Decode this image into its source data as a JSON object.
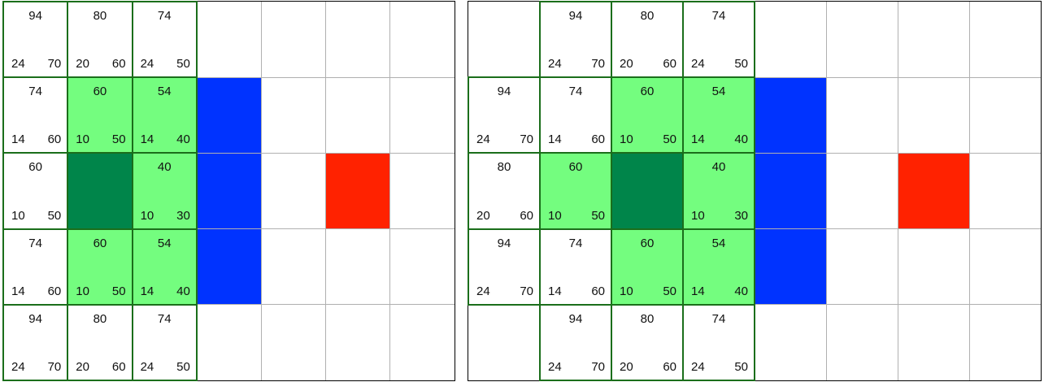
{
  "colors": {
    "open": "#74fd7f",
    "closed": "#ffffff",
    "current": "#00854a",
    "wall": "#0033ff",
    "goal": "#ff2200",
    "border": "#1b6e1b",
    "gridline": "#b0b0b0"
  },
  "legend": {
    "cell_values": "each annotated cell shows f (top), g (bottom-left), h (bottom-right)"
  },
  "panels": [
    {
      "cols": 7,
      "rows": 5,
      "wall_cells": [
        [
          3,
          1
        ],
        [
          3,
          2
        ],
        [
          3,
          3
        ]
      ],
      "goal_cells": [
        [
          5,
          2
        ]
      ],
      "current_cell": [
        1,
        2
      ],
      "cells": [
        {
          "c": 0,
          "r": 0,
          "state": "closed",
          "f": "94",
          "g": "24",
          "h": "70"
        },
        {
          "c": 1,
          "r": 0,
          "state": "closed",
          "f": "80",
          "g": "20",
          "h": "60"
        },
        {
          "c": 2,
          "r": 0,
          "state": "closed",
          "f": "74",
          "g": "24",
          "h": "50"
        },
        {
          "c": 0,
          "r": 1,
          "state": "closed",
          "f": "74",
          "g": "14",
          "h": "60"
        },
        {
          "c": 1,
          "r": 1,
          "state": "open",
          "f": "60",
          "g": "10",
          "h": "50"
        },
        {
          "c": 2,
          "r": 1,
          "state": "open",
          "f": "54",
          "g": "14",
          "h": "40"
        },
        {
          "c": 0,
          "r": 2,
          "state": "closed",
          "f": "60",
          "g": "10",
          "h": "50"
        },
        {
          "c": 2,
          "r": 2,
          "state": "open",
          "f": "40",
          "g": "10",
          "h": "30"
        },
        {
          "c": 0,
          "r": 3,
          "state": "closed",
          "f": "74",
          "g": "14",
          "h": "60"
        },
        {
          "c": 1,
          "r": 3,
          "state": "open",
          "f": "60",
          "g": "10",
          "h": "50"
        },
        {
          "c": 2,
          "r": 3,
          "state": "open",
          "f": "54",
          "g": "14",
          "h": "40"
        },
        {
          "c": 0,
          "r": 4,
          "state": "closed",
          "f": "94",
          "g": "24",
          "h": "70"
        },
        {
          "c": 1,
          "r": 4,
          "state": "closed",
          "f": "80",
          "g": "20",
          "h": "60"
        },
        {
          "c": 2,
          "r": 4,
          "state": "closed",
          "f": "74",
          "g": "24",
          "h": "50"
        }
      ]
    },
    {
      "cols": 8,
      "rows": 5,
      "wall_cells": [
        [
          4,
          1
        ],
        [
          4,
          2
        ],
        [
          4,
          3
        ]
      ],
      "goal_cells": [
        [
          6,
          2
        ]
      ],
      "current_cell": [
        2,
        2
      ],
      "cells": [
        {
          "c": 1,
          "r": 0,
          "state": "closed",
          "f": "94",
          "g": "24",
          "h": "70"
        },
        {
          "c": 2,
          "r": 0,
          "state": "closed",
          "f": "80",
          "g": "20",
          "h": "60"
        },
        {
          "c": 3,
          "r": 0,
          "state": "closed",
          "f": "74",
          "g": "24",
          "h": "50"
        },
        {
          "c": 0,
          "r": 1,
          "state": "closed",
          "f": "94",
          "g": "24",
          "h": "70"
        },
        {
          "c": 1,
          "r": 1,
          "state": "closed",
          "f": "74",
          "g": "14",
          "h": "60"
        },
        {
          "c": 2,
          "r": 1,
          "state": "open",
          "f": "60",
          "g": "10",
          "h": "50"
        },
        {
          "c": 3,
          "r": 1,
          "state": "open",
          "f": "54",
          "g": "14",
          "h": "40"
        },
        {
          "c": 0,
          "r": 2,
          "state": "closed",
          "f": "80",
          "g": "20",
          "h": "60"
        },
        {
          "c": 1,
          "r": 2,
          "state": "open",
          "f": "60",
          "g": "10",
          "h": "50"
        },
        {
          "c": 3,
          "r": 2,
          "state": "open",
          "f": "40",
          "g": "10",
          "h": "30"
        },
        {
          "c": 0,
          "r": 3,
          "state": "closed",
          "f": "94",
          "g": "24",
          "h": "70"
        },
        {
          "c": 1,
          "r": 3,
          "state": "closed",
          "f": "74",
          "g": "14",
          "h": "60"
        },
        {
          "c": 2,
          "r": 3,
          "state": "open",
          "f": "60",
          "g": "10",
          "h": "50"
        },
        {
          "c": 3,
          "r": 3,
          "state": "open",
          "f": "54",
          "g": "14",
          "h": "40"
        },
        {
          "c": 1,
          "r": 4,
          "state": "closed",
          "f": "94",
          "g": "24",
          "h": "70"
        },
        {
          "c": 2,
          "r": 4,
          "state": "closed",
          "f": "80",
          "g": "20",
          "h": "60"
        },
        {
          "c": 3,
          "r": 4,
          "state": "closed",
          "f": "74",
          "g": "24",
          "h": "50"
        }
      ]
    }
  ]
}
